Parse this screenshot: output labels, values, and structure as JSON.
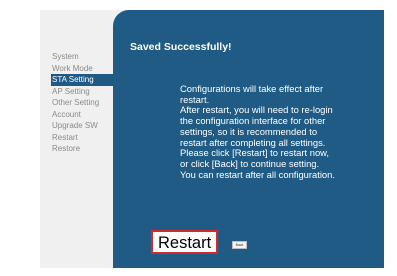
{
  "sidebar": {
    "items": [
      {
        "label": "System"
      },
      {
        "label": "Work Mode"
      },
      {
        "label": "STA Setting"
      },
      {
        "label": "AP Setting"
      },
      {
        "label": "Other Setting"
      },
      {
        "label": "Account"
      },
      {
        "label": "Upgrade SW"
      },
      {
        "label": "Restart"
      },
      {
        "label": "Restore"
      }
    ],
    "active_item": "STA Setting"
  },
  "main": {
    "title": "Saved Successfully!",
    "message_lines": [
      "Configurations will take effect after",
      "restart.",
      "After restart, you will need to re-login",
      "the configuration interface for other",
      "settings, so it is recommended to",
      "restart after completing all settings.",
      "Please click [Restart] to restart now,",
      "or click [Back] to continue setting.",
      "You can restart after all configuration."
    ],
    "restart_label": "Restart",
    "back_label": "Back"
  },
  "colors": {
    "content_background": "#1f5b85",
    "active_nav_background": "#1e5a85",
    "highlight_border": "#d6262e"
  }
}
